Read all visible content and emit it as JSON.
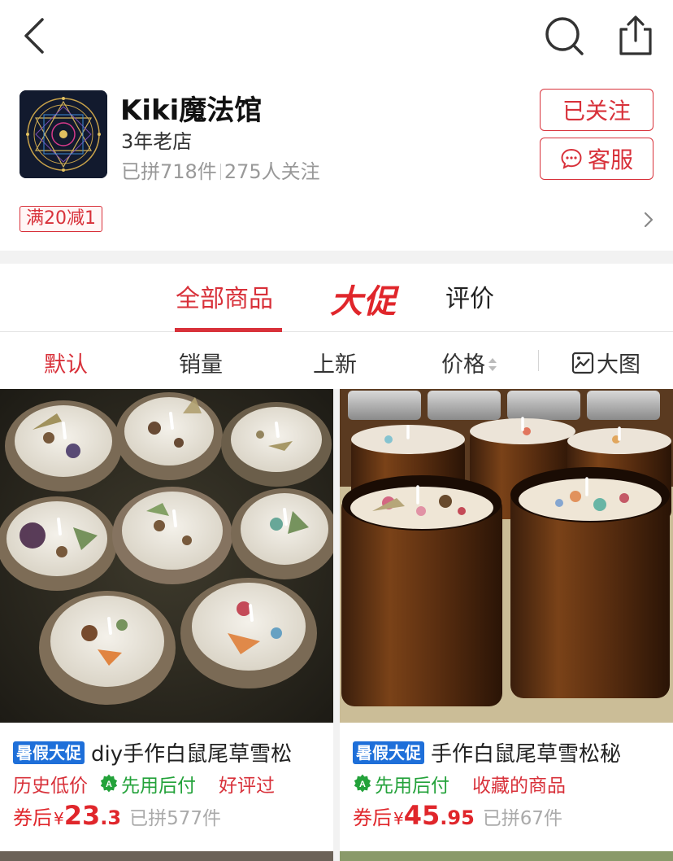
{
  "shop": {
    "name": "Kiki魔法馆",
    "age": "3年老店",
    "sold": "已拼718件",
    "followers": "275人关注",
    "follow_label": "已关注",
    "service_label": "客服",
    "promo": "满20减1"
  },
  "tabs": [
    {
      "label": "全部商品"
    },
    {
      "label": "大促"
    },
    {
      "label": "评价"
    }
  ],
  "sort": [
    "默认",
    "销量",
    "上新",
    "价格",
    "大图"
  ],
  "products": [
    {
      "badge": "暑假大促",
      "title": "diy手作白鼠尾草雪松",
      "tags": [
        "历史低价",
        "先用后付",
        "好评过"
      ],
      "price_label": "券后",
      "currency": "¥",
      "price_int": "23",
      "price_dec": ".3",
      "sold": "已拼577件"
    },
    {
      "badge": "暑假大促",
      "title": "手作白鼠尾草雪松秘",
      "tags": [
        "先用后付",
        "收藏的商品"
      ],
      "price_label": "券后",
      "currency": "¥",
      "price_int": "45",
      "price_dec": ".95",
      "sold": "已拼67件"
    }
  ],
  "colors": {
    "accent": "#d8313a",
    "badge_blue": "#1e6fd9",
    "green": "#23a23a"
  }
}
